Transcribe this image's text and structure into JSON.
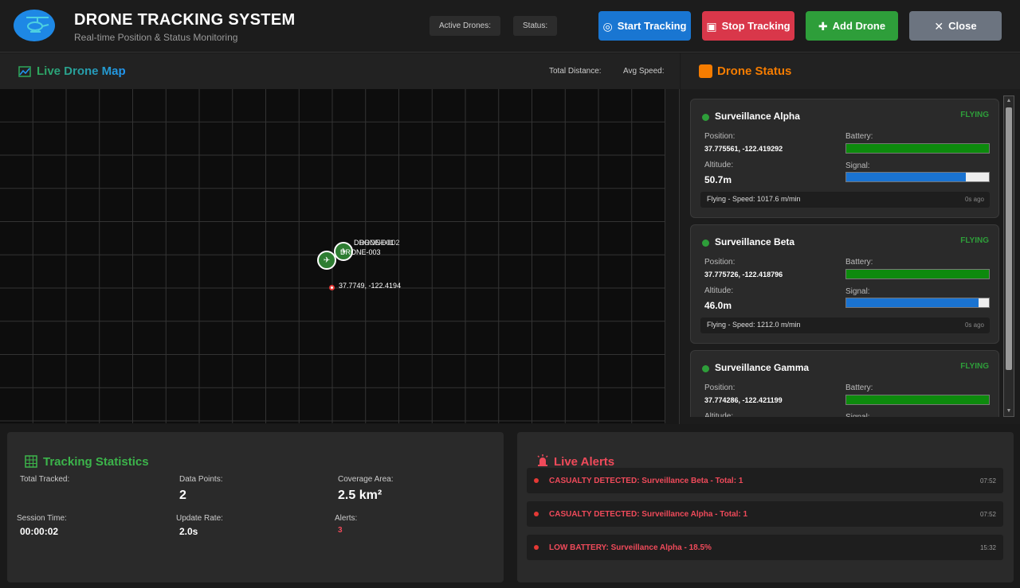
{
  "header": {
    "title": "DRONE TRACKING SYSTEM",
    "subtitle": "Real-time Position & Status Monitoring",
    "active_drones_label": "Active Drones:",
    "status_label": "Status:",
    "buttons": {
      "start": "Start Tracking",
      "stop": "Stop Tracking",
      "add": "Add Drone",
      "close": "Close"
    }
  },
  "map": {
    "title": "Live Drone Map",
    "total_distance_label": "Total Distance:",
    "avg_speed_label": "Avg Speed:",
    "markers": [
      {
        "label": "DRONE-001"
      },
      {
        "label": "DRONE-002"
      },
      {
        "label": "DRONE-003"
      }
    ],
    "position_label": "37.7749, -122.4194"
  },
  "status": {
    "title": "Drone Status",
    "position_label": "Position:",
    "battery_label": "Battery:",
    "altitude_label": "Altitude:",
    "signal_label": "Signal:",
    "drones": [
      {
        "name": "Surveillance Alpha",
        "state": "FLYING",
        "position": "37.775561, -122.419292",
        "altitude": "50.7m",
        "battery": 1.0,
        "signal": 0.84,
        "footer": "Flying - Speed: 1017.6 m/min",
        "ago": "0s ago"
      },
      {
        "name": "Surveillance Beta",
        "state": "FLYING",
        "position": "37.775726, -122.418796",
        "altitude": "46.0m",
        "battery": 1.0,
        "signal": 0.93,
        "footer": "Flying - Speed: 1212.0 m/min",
        "ago": "0s ago"
      },
      {
        "name": "Surveillance Gamma",
        "state": "FLYING",
        "position": "37.774286, -122.421199",
        "altitude": "",
        "battery": 1.0,
        "signal": 0.0,
        "footer": "",
        "ago": ""
      }
    ]
  },
  "stats": {
    "title": "Tracking Statistics",
    "total_tracked_label": "Total Tracked:",
    "data_points_label": "Data Points:",
    "data_points": "2",
    "coverage_label": "Coverage Area:",
    "coverage": "2.5 km²",
    "session_label": "Session Time:",
    "session": "00:00:02",
    "update_label": "Update Rate:",
    "update": "2.0s",
    "alerts_label": "Alerts:",
    "alerts": "3"
  },
  "alerts": {
    "title": "Live Alerts",
    "items": [
      {
        "text": "CASUALTY DETECTED: Surveillance Beta - Total: 1",
        "time": "07:52"
      },
      {
        "text": "CASUALTY DETECTED: Surveillance Alpha - Total: 1",
        "time": "07:52"
      },
      {
        "text": "LOW BATTERY: Surveillance Alpha - 18.5%",
        "time": "15:32"
      }
    ]
  },
  "colors": {
    "accent_blue": "#1976d2",
    "danger": "#d9374a",
    "success": "#2e9e3a",
    "orange": "#f57c00",
    "battery": "#0d8a0d",
    "signal": "#1a73d1"
  }
}
